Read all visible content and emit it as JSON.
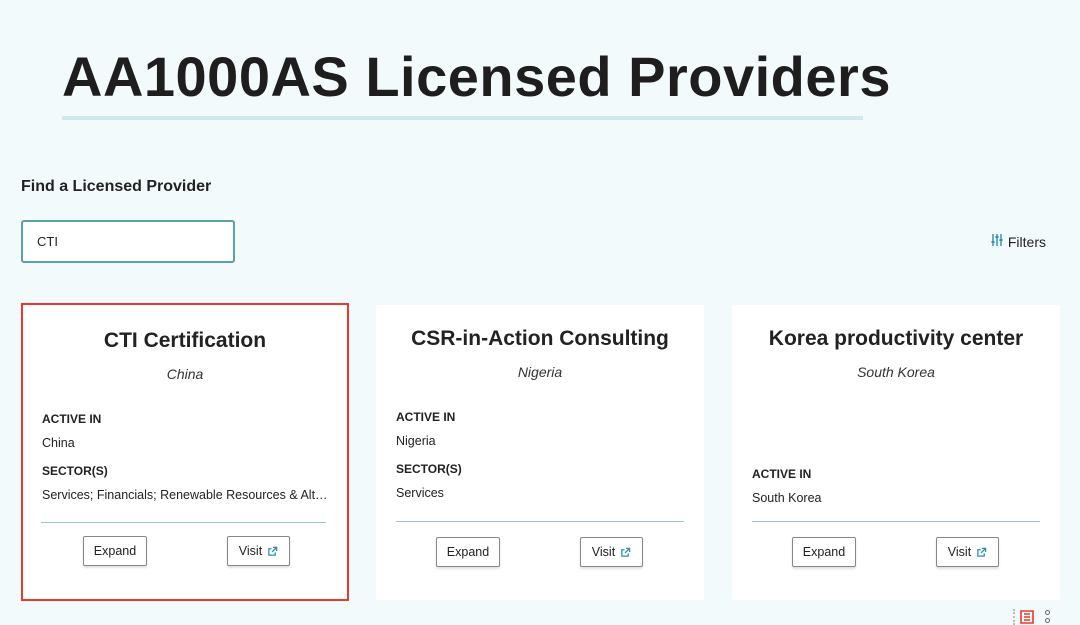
{
  "header": {
    "title": "AA1000AS Licensed Providers"
  },
  "search": {
    "label": "Find a Licensed Provider",
    "value": "CTI",
    "placeholder": ""
  },
  "filters": {
    "label": "Filters",
    "icon": "sliders-icon"
  },
  "cards": [
    {
      "name": "CTI Certification",
      "country": "China",
      "active_in_label": "ACTIVE IN",
      "active_in": "China",
      "sectors_label": "SECTOR(S)",
      "sectors": "Services; Financials; Renewable Resources & Alternative Energy",
      "expand_label": "Expand",
      "visit_label": "Visit",
      "selected": true
    },
    {
      "name": "CSR-in-Action Consulting",
      "country": "Nigeria",
      "active_in_label": "ACTIVE IN",
      "active_in": "Nigeria",
      "sectors_label": "SECTOR(S)",
      "sectors": "Services",
      "expand_label": "Expand",
      "visit_label": "Visit",
      "selected": false
    },
    {
      "name": "Korea productivity center",
      "country": "South Korea",
      "active_in_label": "ACTIVE IN",
      "active_in": "South Korea",
      "expand_label": "Expand",
      "visit_label": "Visit",
      "selected": false
    }
  ],
  "colors": {
    "background": "#f3fafb",
    "accent": "#5aa2a9",
    "selection_outline": "#e53a2c",
    "link_icon": "#2a8fb0"
  }
}
